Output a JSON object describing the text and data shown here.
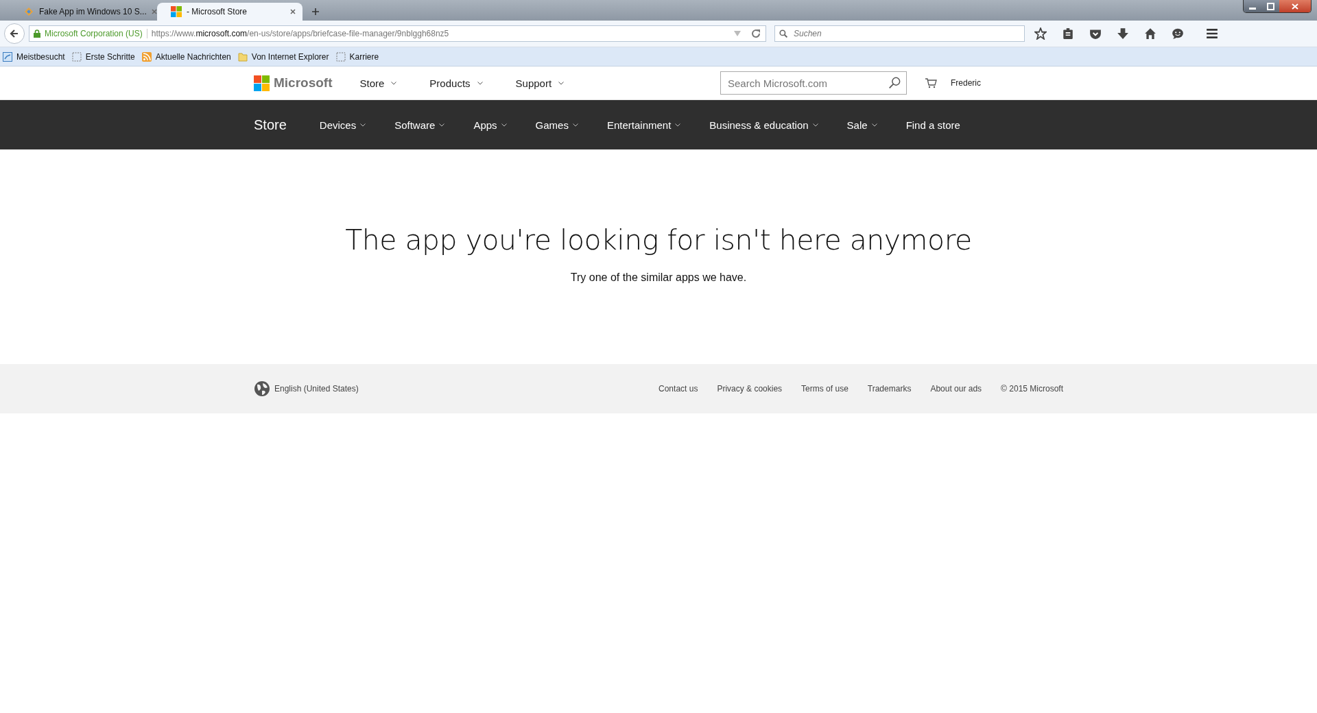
{
  "browser": {
    "tabs": [
      {
        "title": "Fake App im Windows 10 S...",
        "selected": false
      },
      {
        "title": "- Microsoft Store",
        "selected": true
      }
    ],
    "identity": "Microsoft Corporation (US)",
    "url_prefix": "https://www.",
    "url_domain": "microsoft.com",
    "url_path": "/en-us/store/apps/briefcase-file-manager/9nblggh68nz5",
    "search": {
      "placeholder": "Suchen"
    },
    "bookmarks": [
      {
        "label": "Meistbesucht",
        "kind": "app"
      },
      {
        "label": "Erste Schritte",
        "kind": "page"
      },
      {
        "label": "Aktuelle Nachrichten",
        "kind": "feed"
      },
      {
        "label": "Von Internet Explorer",
        "kind": "folder"
      },
      {
        "label": "Karriere",
        "kind": "page"
      }
    ]
  },
  "header": {
    "brand": "Microsoft",
    "nav": [
      "Store",
      "Products",
      "Support"
    ],
    "search": {
      "placeholder": "Search Microsoft.com"
    },
    "user": "Frederic"
  },
  "store_nav": {
    "title": "Store",
    "items": [
      {
        "label": "Devices",
        "dropdown": true
      },
      {
        "label": "Software",
        "dropdown": true
      },
      {
        "label": "Apps",
        "dropdown": true
      },
      {
        "label": "Games",
        "dropdown": true
      },
      {
        "label": "Entertainment",
        "dropdown": true
      },
      {
        "label": "Business & education",
        "dropdown": true
      },
      {
        "label": "Sale",
        "dropdown": true
      },
      {
        "label": "Find a store",
        "dropdown": false
      }
    ]
  },
  "message": {
    "heading": "The app you're looking for isn't here anymore",
    "subtext": "Try one of the similar apps we have."
  },
  "footer": {
    "locale": "English (United States)",
    "links": [
      "Contact us",
      "Privacy & cookies",
      "Terms of use",
      "Trademarks",
      "About our ads"
    ],
    "copyright": "© 2015 Microsoft"
  }
}
